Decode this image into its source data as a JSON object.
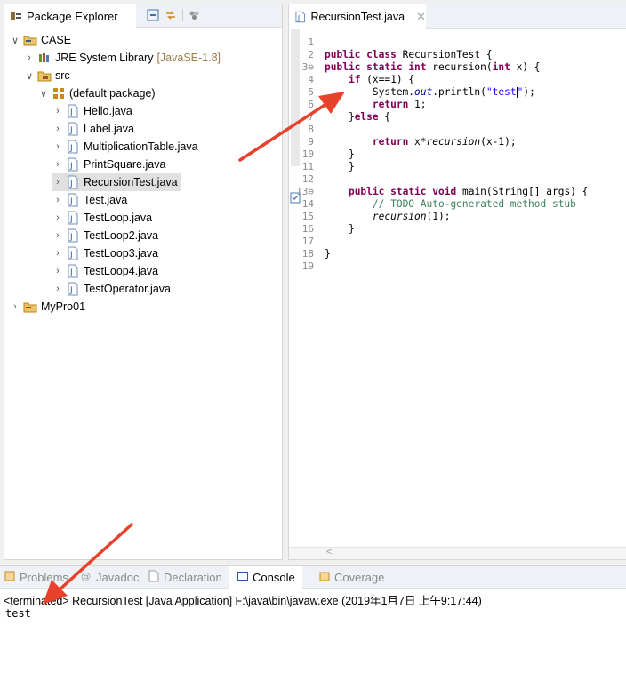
{
  "package_explorer": {
    "title": "Package Explorer",
    "tree": [
      {
        "label": "CASE",
        "chevron": "down",
        "icon": "project-icon",
        "indent": 0
      },
      {
        "label": "JRE System Library",
        "decoration": "[JavaSE-1.8]",
        "chevron": "right",
        "icon": "library-icon",
        "indent": 1
      },
      {
        "label": "src",
        "chevron": "down",
        "icon": "source-folder-icon",
        "indent": 1
      },
      {
        "label": "(default package)",
        "chevron": "down",
        "icon": "package-icon",
        "indent": 2
      },
      {
        "label": "Hello.java",
        "chevron": "right",
        "icon": "java-file-icon",
        "indent": 3
      },
      {
        "label": "Label.java",
        "chevron": "right",
        "icon": "java-file-icon",
        "indent": 3
      },
      {
        "label": "MultiplicationTable.java",
        "chevron": "right",
        "icon": "java-file-icon",
        "indent": 3
      },
      {
        "label": "PrintSquare.java",
        "chevron": "right",
        "icon": "java-file-icon",
        "indent": 3
      },
      {
        "label": "RecursionTest.java",
        "chevron": "right",
        "icon": "java-file-icon",
        "indent": 3,
        "selected": true
      },
      {
        "label": "Test.java",
        "chevron": "right",
        "icon": "java-file-icon",
        "indent": 3
      },
      {
        "label": "TestLoop.java",
        "chevron": "right",
        "icon": "java-file-icon",
        "indent": 3
      },
      {
        "label": "TestLoop2.java",
        "chevron": "right",
        "icon": "java-file-icon",
        "indent": 3
      },
      {
        "label": "TestLoop3.java",
        "chevron": "right",
        "icon": "java-file-icon",
        "indent": 3
      },
      {
        "label": "TestLoop4.java",
        "chevron": "right",
        "icon": "java-file-icon",
        "indent": 3
      },
      {
        "label": "TestOperator.java",
        "chevron": "right",
        "icon": "java-file-icon",
        "indent": 3
      },
      {
        "label": "MyPro01",
        "chevron": "right",
        "icon": "project-icon",
        "indent": 0
      }
    ]
  },
  "editor": {
    "tab_label": "RecursionTest.java",
    "lines": [
      {
        "n": "1",
        "tokens": []
      },
      {
        "n": "2",
        "tokens": [
          {
            "t": "public ",
            "c": "kw"
          },
          {
            "t": "class ",
            "c": "kw"
          },
          {
            "t": "RecursionTest {",
            "c": ""
          }
        ]
      },
      {
        "n": "3⊖",
        "tokens": [
          {
            "t": "public ",
            "c": "kw"
          },
          {
            "t": "static ",
            "c": "kw"
          },
          {
            "t": "int ",
            "c": "kw"
          },
          {
            "t": "recursion(",
            "c": ""
          },
          {
            "t": "int ",
            "c": "kw"
          },
          {
            "t": "x) {",
            "c": ""
          }
        ]
      },
      {
        "n": "4",
        "tokens": [
          {
            "t": "    ",
            "c": ""
          },
          {
            "t": "if ",
            "c": "kw"
          },
          {
            "t": "(x==1) {",
            "c": ""
          }
        ]
      },
      {
        "n": "5",
        "tokens": [
          {
            "t": "        System.",
            "c": ""
          },
          {
            "t": "out",
            "c": "fld"
          },
          {
            "t": ".println(",
            "c": ""
          },
          {
            "t": "\"test",
            "c": "str"
          },
          {
            "t": "|",
            "c": "caret"
          },
          {
            "t": "\"",
            "c": "str"
          },
          {
            "t": ");",
            "c": ""
          }
        ]
      },
      {
        "n": "6",
        "tokens": [
          {
            "t": "        ",
            "c": ""
          },
          {
            "t": "return ",
            "c": "kw"
          },
          {
            "t": "1;",
            "c": ""
          }
        ]
      },
      {
        "n": "7",
        "tokens": [
          {
            "t": "    }",
            "c": ""
          },
          {
            "t": "else ",
            "c": "kw"
          },
          {
            "t": "{",
            "c": ""
          }
        ]
      },
      {
        "n": "8",
        "tokens": []
      },
      {
        "n": "9",
        "tokens": [
          {
            "t": "        ",
            "c": ""
          },
          {
            "t": "return ",
            "c": "kw"
          },
          {
            "t": "x*",
            "c": ""
          },
          {
            "t": "recursion",
            "c": "it"
          },
          {
            "t": "(x-1);",
            "c": ""
          }
        ]
      },
      {
        "n": "10",
        "tokens": [
          {
            "t": "    }",
            "c": ""
          }
        ]
      },
      {
        "n": "11",
        "tokens": [
          {
            "t": "    }",
            "c": ""
          }
        ]
      },
      {
        "n": "12",
        "tokens": []
      },
      {
        "n": "13⊖",
        "tokens": [
          {
            "t": "    ",
            "c": ""
          },
          {
            "t": "public ",
            "c": "kw"
          },
          {
            "t": "static ",
            "c": "kw"
          },
          {
            "t": "void ",
            "c": "kw"
          },
          {
            "t": "main(String[] args) {",
            "c": ""
          }
        ]
      },
      {
        "n": "14",
        "tokens": [
          {
            "t": "        ",
            "c": ""
          },
          {
            "t": "// TODO Auto-generated method stub",
            "c": "cm"
          }
        ]
      },
      {
        "n": "15",
        "tokens": [
          {
            "t": "        ",
            "c": ""
          },
          {
            "t": "recursion",
            "c": "it"
          },
          {
            "t": "(1);",
            "c": ""
          }
        ]
      },
      {
        "n": "16",
        "tokens": [
          {
            "t": "    }",
            "c": ""
          }
        ]
      },
      {
        "n": "17",
        "tokens": []
      },
      {
        "n": "18",
        "tokens": [
          {
            "t": "}",
            "c": ""
          }
        ]
      },
      {
        "n": "19",
        "tokens": []
      }
    ]
  },
  "bottom": {
    "tabs": [
      {
        "label": "Problems",
        "icon": "problems-icon",
        "active": false
      },
      {
        "label": "Javadoc",
        "icon": "javadoc-icon",
        "active": false
      },
      {
        "label": "Declaration",
        "icon": "declaration-icon",
        "active": false
      },
      {
        "label": "Console",
        "icon": "console-icon",
        "active": true
      },
      {
        "label": "Coverage",
        "icon": "coverage-icon",
        "active": false
      }
    ],
    "console_header": "<terminated> RecursionTest [Java Application] F:\\java\\bin\\javaw.exe (2019年1月7日 上午9:17:44)",
    "console_output": "test"
  },
  "colors": {
    "keyword": "#7f0055",
    "string": "#2a00ff",
    "comment": "#3f7f5f",
    "field": "#0000c0",
    "arrow": "#e8412c"
  }
}
